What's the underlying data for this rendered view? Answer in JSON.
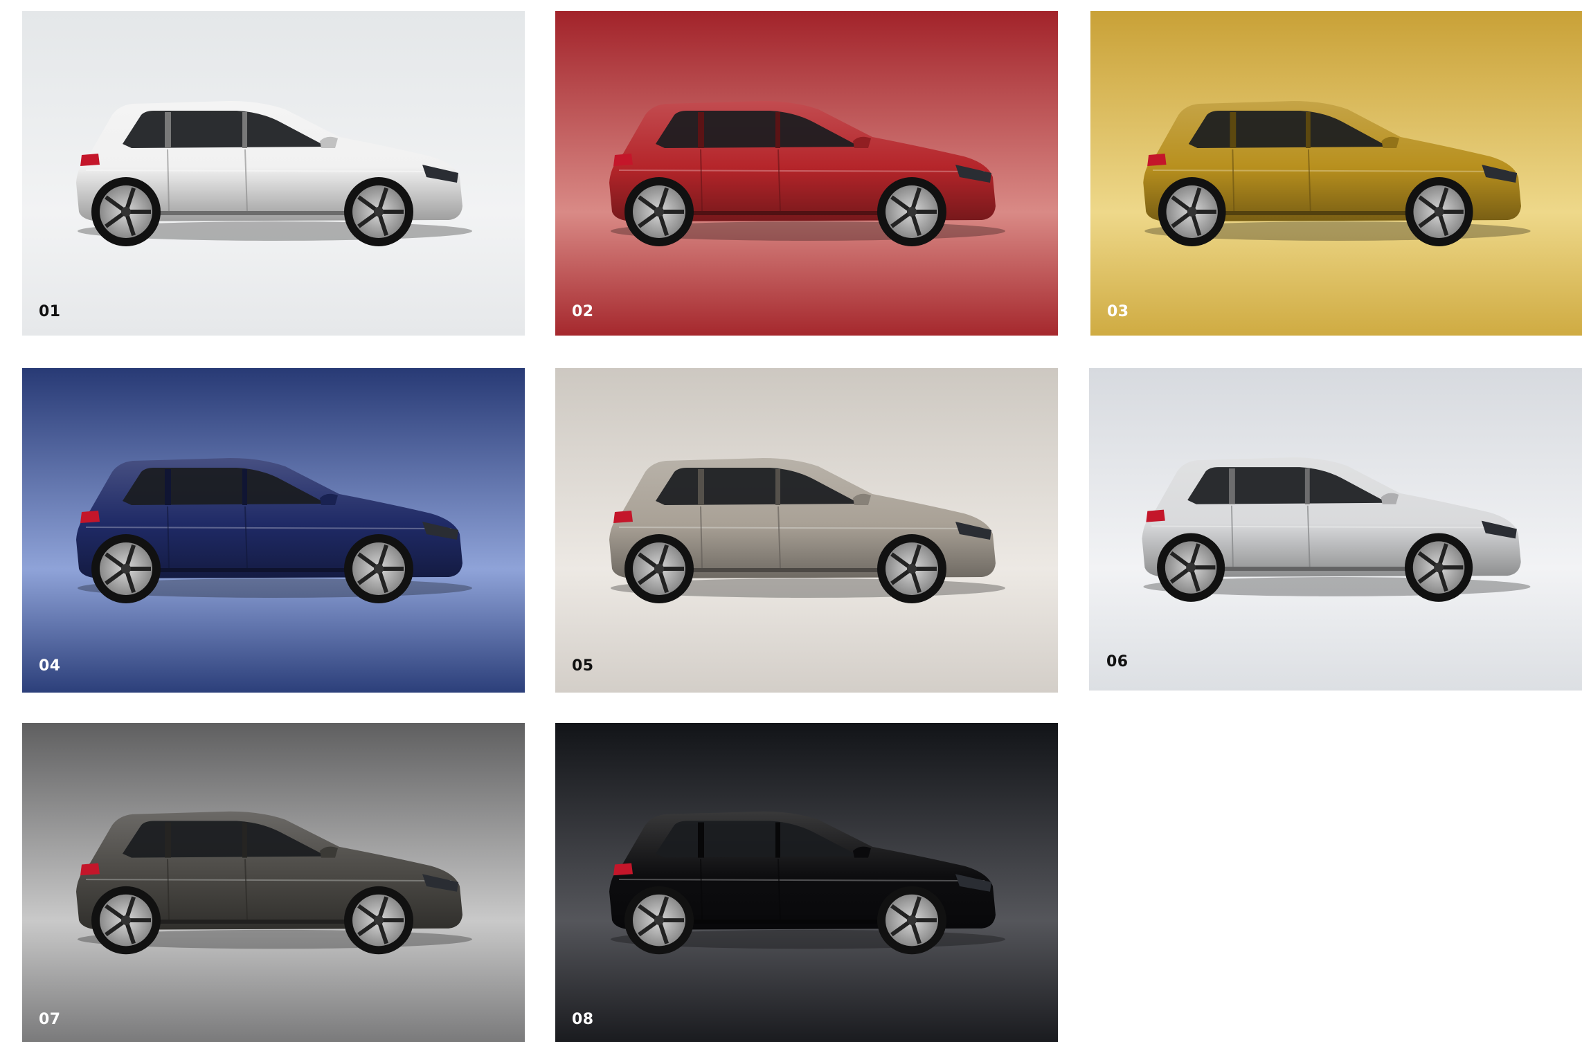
{
  "tiles": [
    {
      "number": "01",
      "background": [
        "#e4e7e9",
        "#f2f3f4",
        "#e6e8ea"
      ],
      "car_color": "#f1f1f1",
      "label_color": "#111111"
    },
    {
      "number": "02",
      "background": [
        "#a2232a",
        "#d98a86",
        "#a5282d"
      ],
      "car_color": "#b5252a",
      "label_color": "#ffffff"
    },
    {
      "number": "03",
      "background": [
        "#c9a137",
        "#eed88a",
        "#cfab42"
      ],
      "car_color": "#b8901e",
      "label_color": "#ffffff"
    },
    {
      "number": "04",
      "background": [
        "#283a75",
        "#8fa3d8",
        "#2c3f7a"
      ],
      "car_color": "#1f2a66",
      "label_color": "#ffffff"
    },
    {
      "number": "05",
      "background": [
        "#cdc8c1",
        "#ede9e4",
        "#d3cec8"
      ],
      "car_color": "#a9a196",
      "label_color": "#111111"
    },
    {
      "number": "06",
      "background": [
        "#d7dadf",
        "#f2f3f5",
        "#dcdfe3"
      ],
      "car_color": "#d9dadc",
      "label_color": "#111111"
    },
    {
      "number": "07",
      "background": [
        "#5f5f60",
        "#c9c9c9",
        "#7a7a7b"
      ],
      "car_color": "#4a4844",
      "label_color": "#ffffff"
    },
    {
      "number": "08",
      "background": [
        "#121418",
        "#55565b",
        "#1a1b1f"
      ],
      "car_color": "#0d0d0f",
      "label_color": "#ffffff"
    }
  ]
}
